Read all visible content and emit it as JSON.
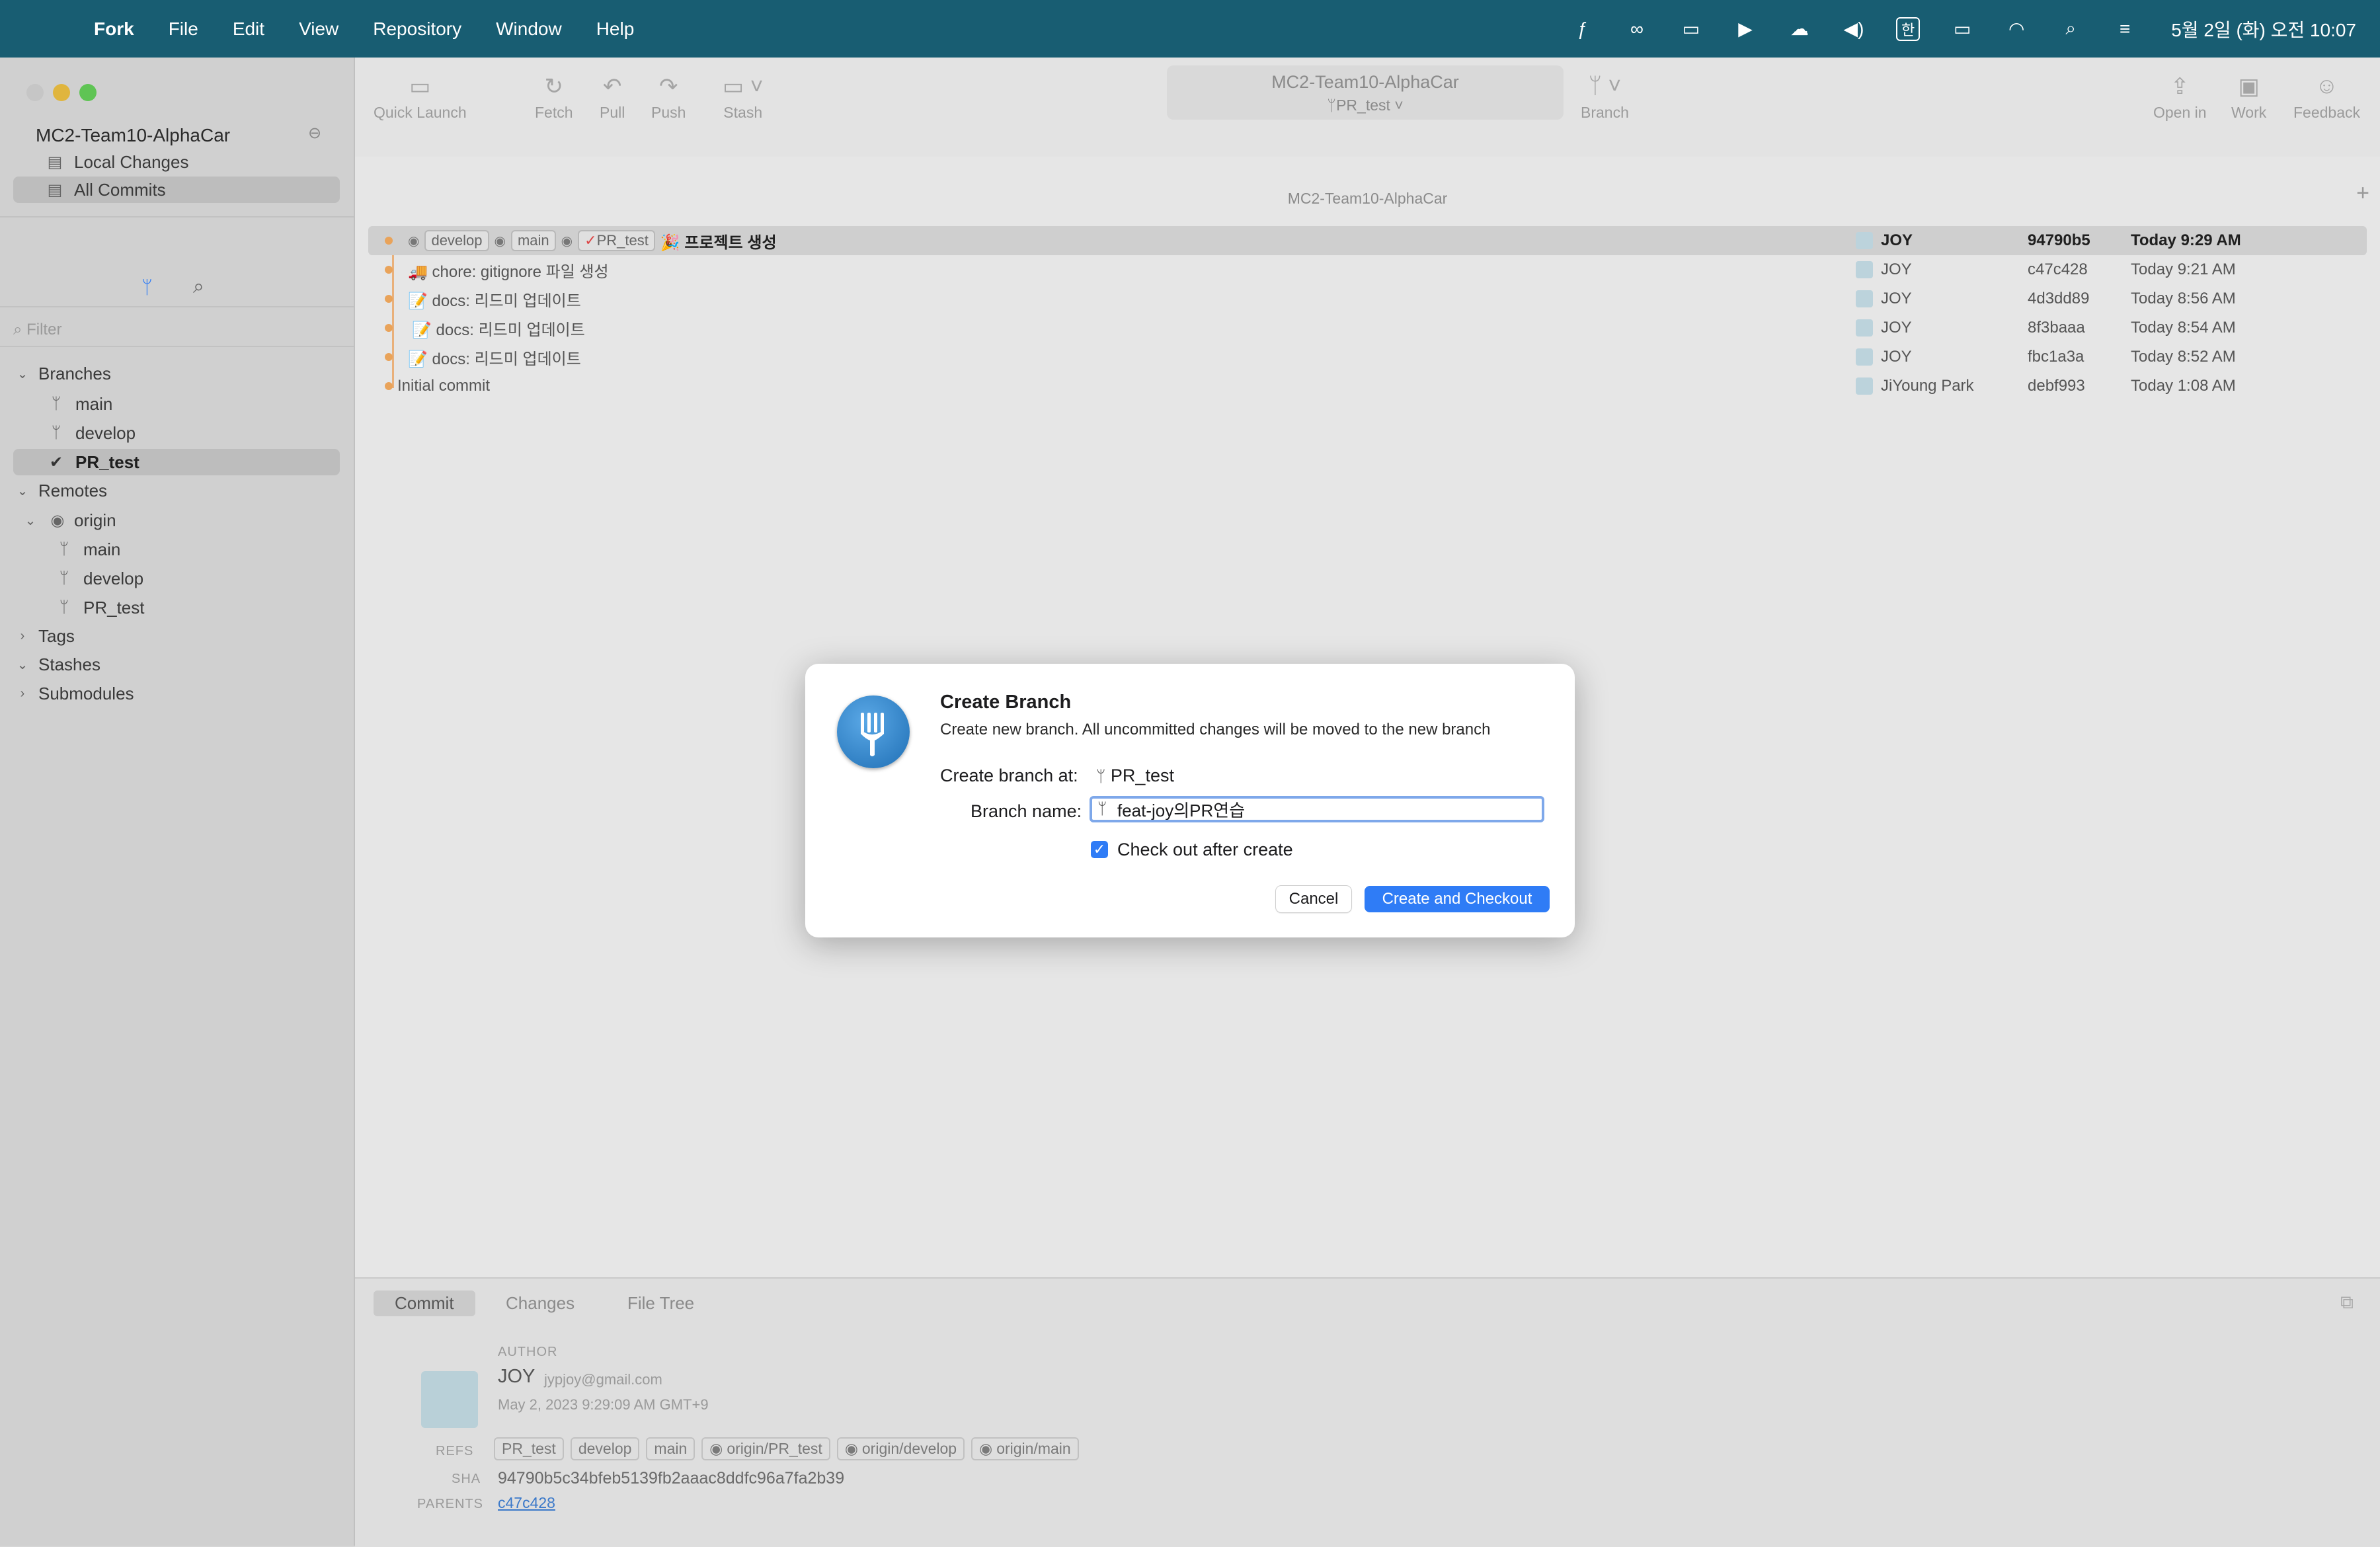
{
  "menubar": {
    "app": "Fork",
    "items": [
      "File",
      "Edit",
      "View",
      "Repository",
      "Window",
      "Help"
    ],
    "input_source": "한",
    "clock": "5월 2일 (화) 오전 10:07"
  },
  "sidebar": {
    "repo_name": "MC2-Team10-AlphaCar",
    "local_changes": "Local Changes",
    "all_commits": "All Commits",
    "filter_placeholder": "Filter",
    "branches_label": "Branches",
    "branches": [
      "main",
      "develop",
      "PR_test"
    ],
    "remotes_label": "Remotes",
    "origin": "origin",
    "remote_branches": [
      "main",
      "develop",
      "PR_test"
    ],
    "tags_label": "Tags",
    "stashes_label": "Stashes",
    "submodules_label": "Submodules"
  },
  "toolbar": {
    "quick_launch": "Quick Launch",
    "fetch": "Fetch",
    "pull": "Pull",
    "push": "Push",
    "stash": "Stash",
    "repo_title": "MC2-Team10-AlphaCar",
    "current_branch": "PR_test",
    "branch": "Branch",
    "open_in": "Open in",
    "work": "Work",
    "feedback": "Feedback"
  },
  "tab_title": "MC2-Team10-AlphaCar",
  "commits": [
    {
      "refs": [
        "develop",
        "main",
        "PR_test"
      ],
      "message": "🎉 프로젝트 생성",
      "author": "JOY",
      "sha": "94790b5",
      "date": "Today 9:29 AM"
    },
    {
      "refs": [],
      "message": "🚚 chore: gitignore 파일 생성",
      "author": "JOY",
      "sha": "c47c428",
      "date": "Today 9:21 AM"
    },
    {
      "refs": [],
      "message": "📝 docs: 리드미 업데이트",
      "author": "JOY",
      "sha": "4d3dd89",
      "date": "Today 8:56 AM"
    },
    {
      "refs": [],
      "message": "📝 docs: 리드미 업데이트",
      "author": "JOY",
      "sha": "8f3baaa",
      "date": "Today 8:54 AM"
    },
    {
      "refs": [],
      "message": "📝 docs: 리드미 업데이트",
      "author": "JOY",
      "sha": "fbc1a3a",
      "date": "Today 8:52 AM"
    },
    {
      "refs": [],
      "message": "Initial commit",
      "author": "JiYoung Park",
      "sha": "debf993",
      "date": "Today 1:08 AM"
    }
  ],
  "detail": {
    "tabs": [
      "Commit",
      "Changes",
      "File Tree"
    ],
    "author_label": "AUTHOR",
    "author_name": "JOY",
    "author_email": "jypjoy@gmail.com",
    "author_date": "May 2, 2023 9:29:09 AM GMT+9",
    "refs_label": "REFS",
    "refs": [
      "PR_test",
      "develop",
      "main",
      "origin/PR_test",
      "origin/develop",
      "origin/main"
    ],
    "sha_label": "SHA",
    "sha": "94790b5c34bfeb5139fb2aaac8ddfc96a7fa2b39",
    "parents_label": "PARENTS",
    "parent": "c47c428"
  },
  "dialog": {
    "title": "Create Branch",
    "subtitle": "Create new branch. All uncommitted changes will be moved to the new branch",
    "create_at_label": "Create branch at:",
    "create_at_value": "PR_test",
    "branch_name_label": "Branch name:",
    "branch_name_value": "feat-joy의PR연습",
    "checkout_label": "Check out after create",
    "checkout_checked": true,
    "cancel": "Cancel",
    "confirm": "Create and Checkout"
  },
  "colors": {
    "menubar": "#185d72",
    "accent": "#2f7cf6",
    "graph": "#e9a35a"
  }
}
